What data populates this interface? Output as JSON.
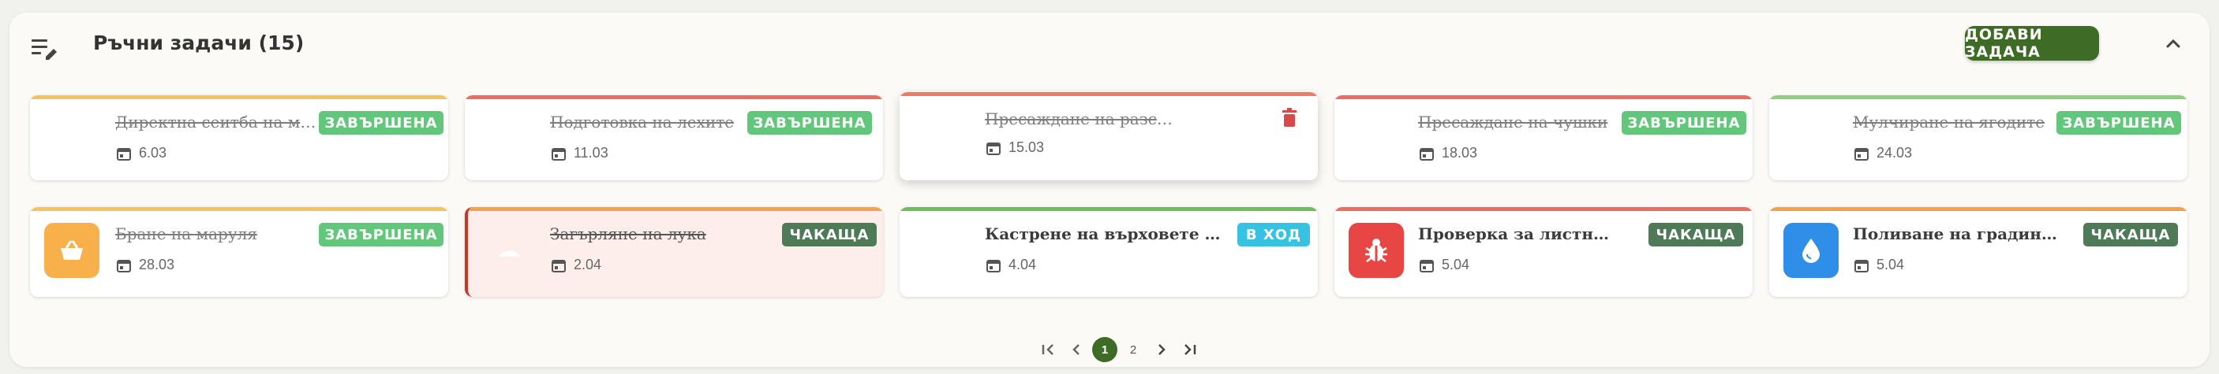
{
  "header": {
    "title": "Ръчни задачи (15)",
    "add_button": "ДОБАВИ ЗАДАЧА",
    "icons": {
      "menu": "list-edit-icon",
      "collapse": "chevron-up-icon"
    }
  },
  "colors": {
    "accent": "#3e6b25",
    "done": "#63c77b",
    "waiting": "#4f7a58",
    "in_progress": "#36c2e0",
    "delete": "#d84a4a"
  },
  "tasks": [
    {
      "name": "Директна сеитба на моркови",
      "date": "6.03",
      "status": "ЗАВЪРШЕНА",
      "done": true
    },
    {
      "name": "Подготовка на лехите",
      "date": "11.03",
      "status": "ЗАВЪРШЕНА",
      "done": true
    },
    {
      "name": "Пресаждане на разсади…",
      "date": "15.03",
      "status": "",
      "done": true,
      "icon": "trash-icon"
    },
    {
      "name": "Пресаждане на чушки",
      "date": "18.03",
      "status": "ЗАВЪРШЕНА",
      "done": true
    },
    {
      "name": "Мулчиране на ягодите",
      "date": "24.03",
      "status": "ЗАВЪРШЕНА",
      "done": true
    },
    {
      "name": "Бране на маруля",
      "date": "28.03",
      "status": "ЗАВЪРШЕНА",
      "done": true,
      "icon": "basket-icon"
    },
    {
      "name": "Загърляне на лука",
      "date": "2.04",
      "status": "ЧАКАЩА",
      "done": false,
      "icon": "mound-icon"
    },
    {
      "name": "Кастрене на върховете на босилека",
      "date": "4.04",
      "status": "В ХОД",
      "done": false
    },
    {
      "name": "Проверка за листни въшки",
      "date": "5.04",
      "status": "ЧАКАЩА",
      "done": false,
      "icon": "bug-icon"
    },
    {
      "name": "Поливане на градината",
      "date": "5.04",
      "status": "ЧАКАЩА",
      "done": false,
      "icon": "water-drop-icon"
    }
  ],
  "pagination": {
    "pages": [
      "1",
      "2"
    ],
    "current": "1"
  }
}
